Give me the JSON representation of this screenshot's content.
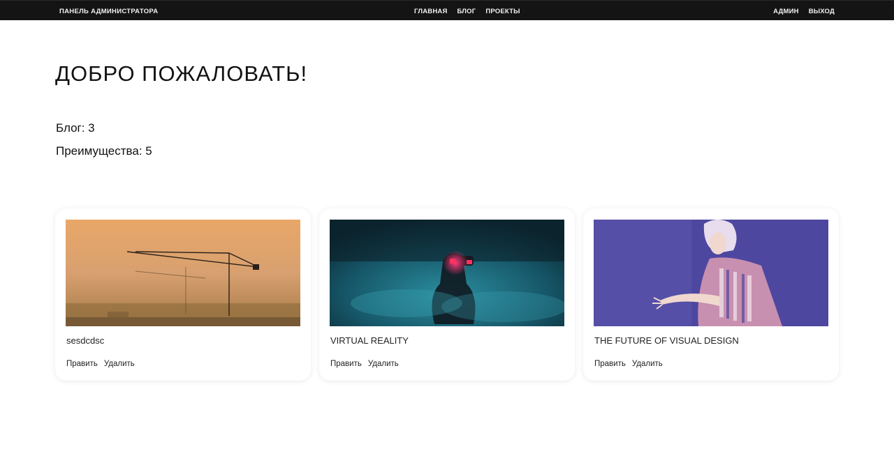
{
  "header": {
    "brand": "ПАНЕЛЬ АДМИНИСТРАТОРА",
    "nav": [
      "ГЛАВНАЯ",
      "БЛОГ",
      "ПРОЕКТЫ"
    ],
    "user_nav": [
      "АДМИН",
      "ВЫХОД"
    ]
  },
  "main": {
    "welcome": "ДОБРО ПОЖАЛОВАТЬ!",
    "stats": {
      "blog": "Блог: 3",
      "advantages": "Преимущества: 5"
    }
  },
  "cards": [
    {
      "title": "sesdcdsc",
      "edit": "Править",
      "delete": "Удалить",
      "image": "construction-cranes-foggy-sunset"
    },
    {
      "title": "VIRTUAL REALITY",
      "edit": "Править",
      "delete": "Удалить",
      "image": "person-vr-headset-teal-smoke"
    },
    {
      "title": "THE FUTURE OF VISUAL DESIGN",
      "edit": "Править",
      "delete": "Удалить",
      "image": "woman-purple-background-reaching"
    }
  ],
  "colors": {
    "topbar": "#141414",
    "nav_text": "#f2f2f2",
    "text": "#111111",
    "card_bg": "#ffffff"
  }
}
